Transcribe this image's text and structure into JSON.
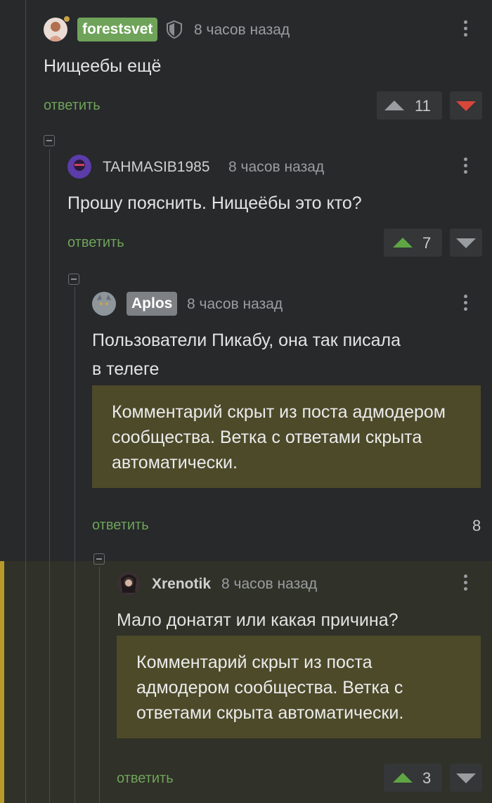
{
  "colors": {
    "accent_green": "#6fa35a",
    "vote_up_active": "#5fa544",
    "vote_down_active": "#d9473a",
    "hidden_bg": "#4d4a2a",
    "highlight_bar": "#b89a2a",
    "badge_green": "#6fa35a",
    "badge_gray": "#7d8084"
  },
  "comments": [
    {
      "user": "forestsvet",
      "time": "8 часов назад",
      "text": "Нищеебы ещё",
      "reply": "ответить",
      "rating": "11",
      "icons": [
        "avatar",
        "shield-icon",
        "more-icon",
        "arrow-up-icon",
        "arrow-down-icon"
      ]
    },
    {
      "user": "TAHMASIB1985",
      "time": "8 часов назад",
      "text": "Прошу пояснить. Нищеёбы это кто?",
      "reply": "ответить",
      "rating": "7"
    },
    {
      "user": "Aplos",
      "time": "8 часов назад",
      "text_line1": "Пользователи Пикабу, она так писала",
      "text_line2": "в телеге",
      "hidden": "Комментарий скрыт из поста адмодером сообщества. Ветка с ответами скрыта автоматически.",
      "reply": "ответить",
      "rating": "8"
    },
    {
      "user": "Xrenotik",
      "time": "8 часов назад",
      "text": "Мало донатят или какая причина?",
      "hidden": "Комментарий скрыт из поста адмодером сообщества. Ветка с ответами скрыта автоматически.",
      "reply": "ответить",
      "rating": "3"
    }
  ]
}
